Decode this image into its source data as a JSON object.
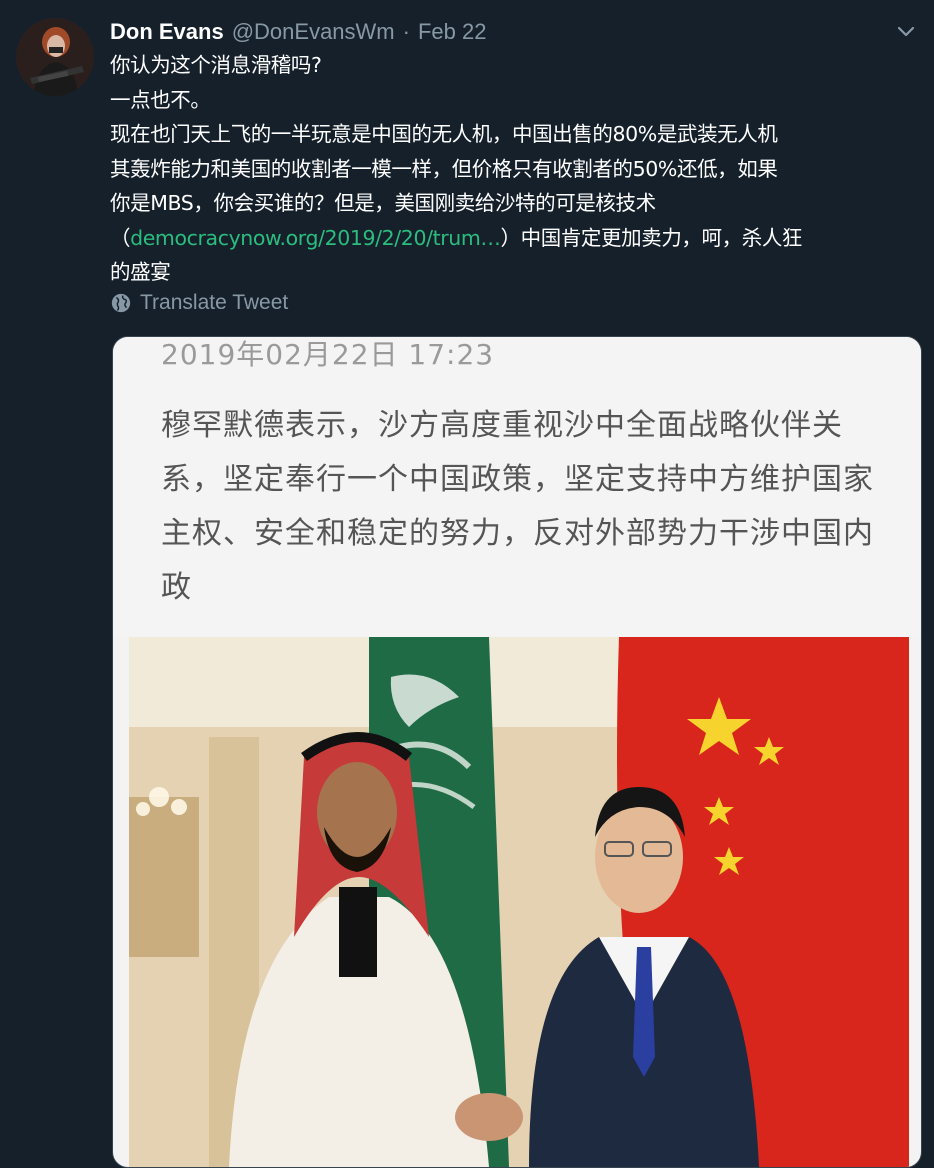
{
  "user": {
    "display_name": "Don Evans",
    "handle": "@DonEvansWm",
    "separator": "·",
    "date": "Feb 22"
  },
  "tweet": {
    "lines": [
      "你认为这个消息滑稽吗?",
      "一点也不。",
      "现在也门天上飞的一半玩意是中国的无人机，中国出售的80%是武装无人机",
      "其轰炸能力和美国的收割者一模一样，但价格只有收割者的50%还低，如果",
      "你是MBS，你会买谁的？但是，美国刚卖给沙特的可是核技术"
    ],
    "line6_prefix": "（",
    "link_text": "democracynow.org/2019/2/20/trum…",
    "line6_suffix": "）中国肯定更加卖力，呵，杀人狂",
    "line7": "的盛宴"
  },
  "translate": {
    "label": "Translate Tweet",
    "icon": "globe-icon"
  },
  "media": {
    "date": "2019年02月22日 17:23",
    "caption_lines": [
      "穆罕默德表示，沙方高度重视沙中全面战略伙伴关",
      "系，坚定奉行一个中国政策，坚定支持中方维护国家",
      "主权、安全和稳定的努力，反对外部势力干涉中国内",
      "政"
    ]
  },
  "colors": {
    "background": "#15202b",
    "secondary_text": "#8899a6",
    "link": "#2bbd7e"
  }
}
